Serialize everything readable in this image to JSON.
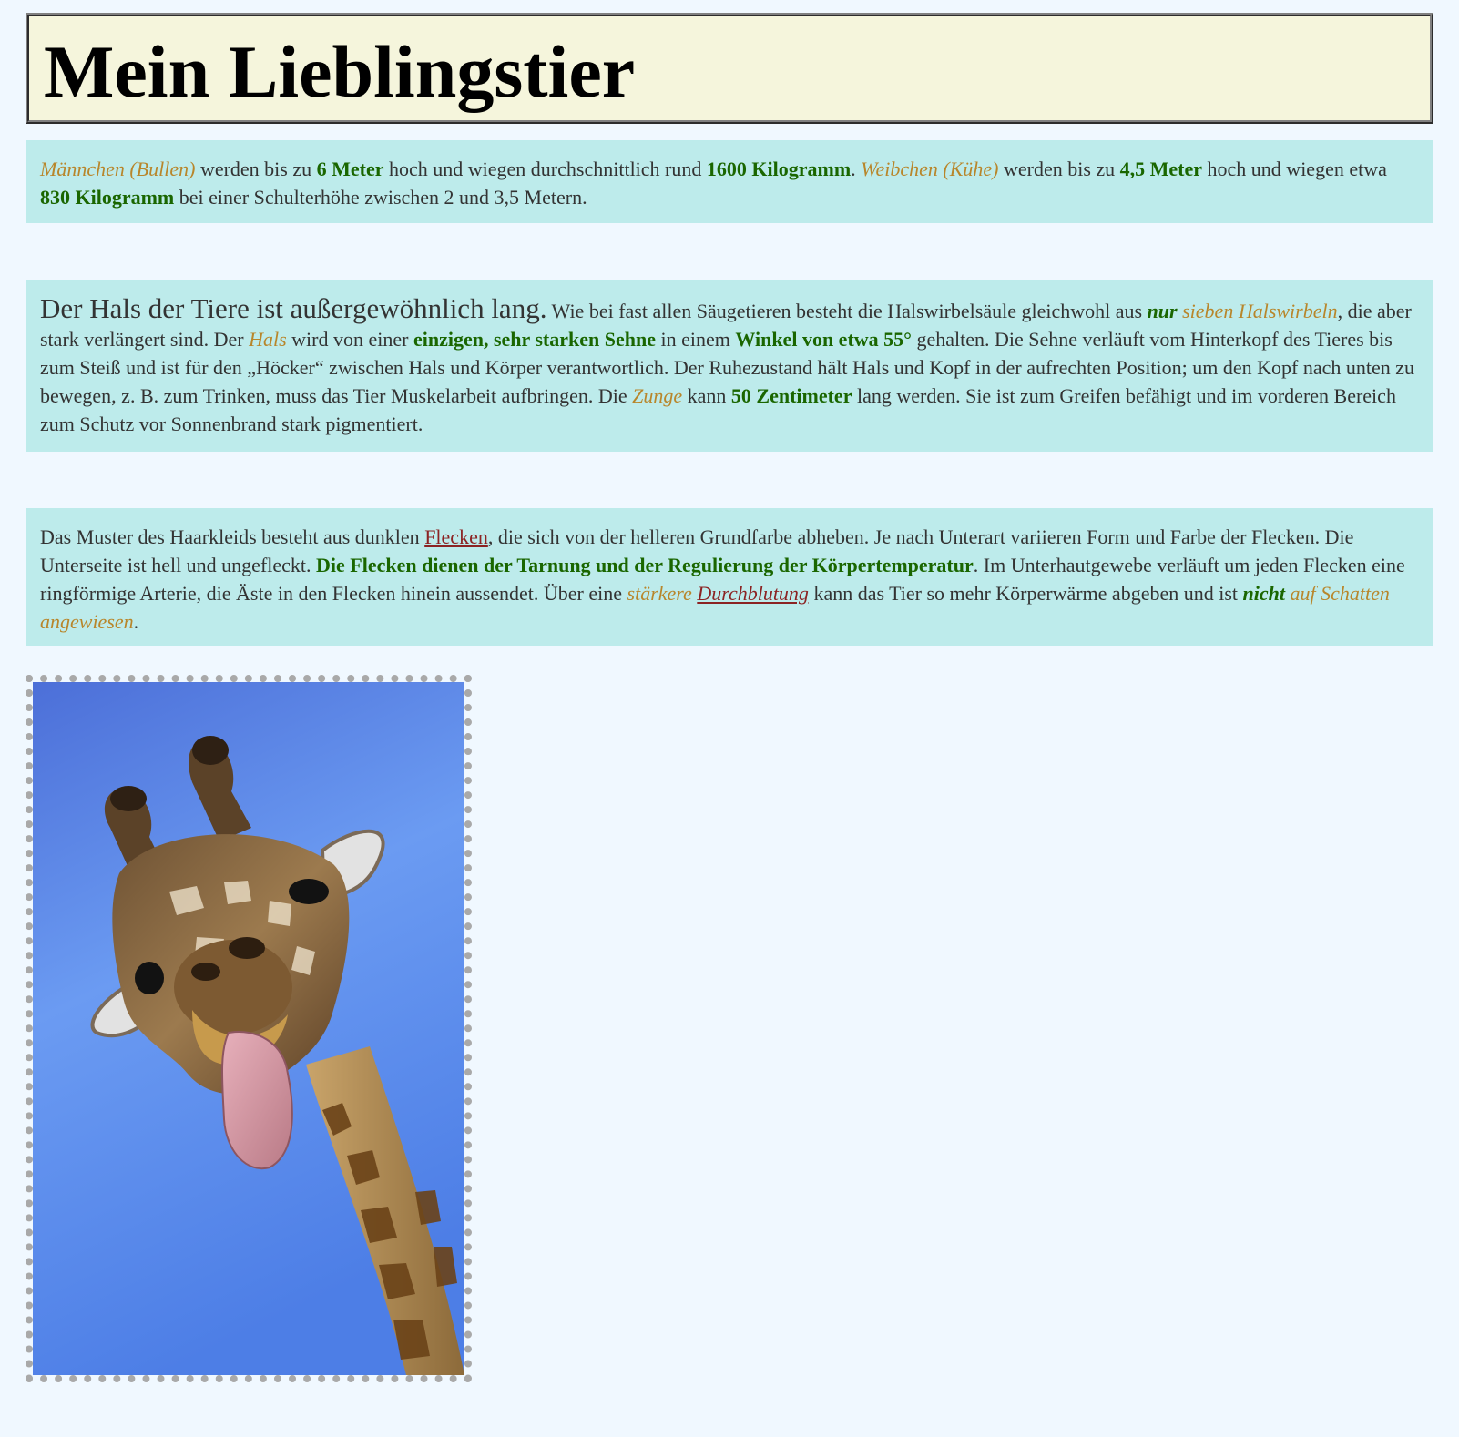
{
  "page": {
    "title": "Mein Lieblingstier"
  },
  "p1": {
    "s1": "Männchen (Bullen)",
    "t1": " werden bis zu ",
    "s2": "6 Meter",
    "t2": " hoch und wiegen durchschnittlich rund ",
    "s3": "1600 Kilogramm",
    "t3": ". ",
    "s4": "Weibchen (Kühe)",
    "t4": " werden bis zu ",
    "s5": "4,5 Meter",
    "t5": " hoch und wiegen etwa ",
    "s6": "830 Kilogramm",
    "t6": " bei einer Schulterhöhe zwischen 2 und 3,5 Metern."
  },
  "p2": {
    "lead": "Der Hals der Tiere ist außergewöhnlich lang.",
    "t1": " Wie bei fast allen Säugetieren besteht die Halswirbelsäule gleichwohl aus ",
    "s1": "nur",
    "t1b": " ",
    "s2": "sieben Halswirbeln",
    "t2": ", die aber stark verlängert sind. Der ",
    "s3": "Hals",
    "t3": " wird von einer ",
    "s4": "einzigen, sehr starken Sehne",
    "t4": " in einem ",
    "s5": "Winkel von etwa 55°",
    "t5": " gehalten. Die Sehne verläuft vom Hinterkopf des Tieres bis zum Steiß und ist für den „Höcker“ zwischen Hals und Körper verantwortlich. Der Ruhezustand hält Hals und Kopf in der aufrechten Position; um den Kopf nach unten zu bewegen, z. B. zum Trinken, muss das Tier Muskelarbeit aufbringen. Die ",
    "s6": "Zunge",
    "t6": " kann ",
    "s7": "50 Zentimeter",
    "t7": " lang werden. Sie ist zum Greifen befähigt und im vorderen Bereich zum Schutz vor Sonnenbrand stark pigmentiert."
  },
  "p3": {
    "t1": "Das Muster des Haarkleids besteht aus dunklen ",
    "link1": "Flecken",
    "t2": ", die sich von der helleren Grundfarbe abheben. Je nach Unterart variieren Form und Farbe der Flecken. Die Unterseite ist hell und ungefleckt. ",
    "s1": "Die Flecken dienen der Tarnung und der Regulierung der Körpertemperatur",
    "t3": ". Im Unterhautgewebe verläuft um jeden Flecken eine ringförmige Arterie, die Äste in den Flecken hinein aussendet. Über eine ",
    "s2": "stärkere",
    "t3b": " ",
    "link2": "Durchblutung",
    "t4": " kann das Tier so mehr Körperwärme abgeben und ist ",
    "s3": "nicht",
    "t4b": " ",
    "s4": "auf Schatten angewiesen",
    "t5": "."
  },
  "photo": {
    "subject": "giraffe-photo",
    "colors": {
      "sky": "#5a88ec",
      "fur": "#8a6a3e",
      "spots": "#6b4318",
      "tongue": "#d99aa6"
    }
  }
}
